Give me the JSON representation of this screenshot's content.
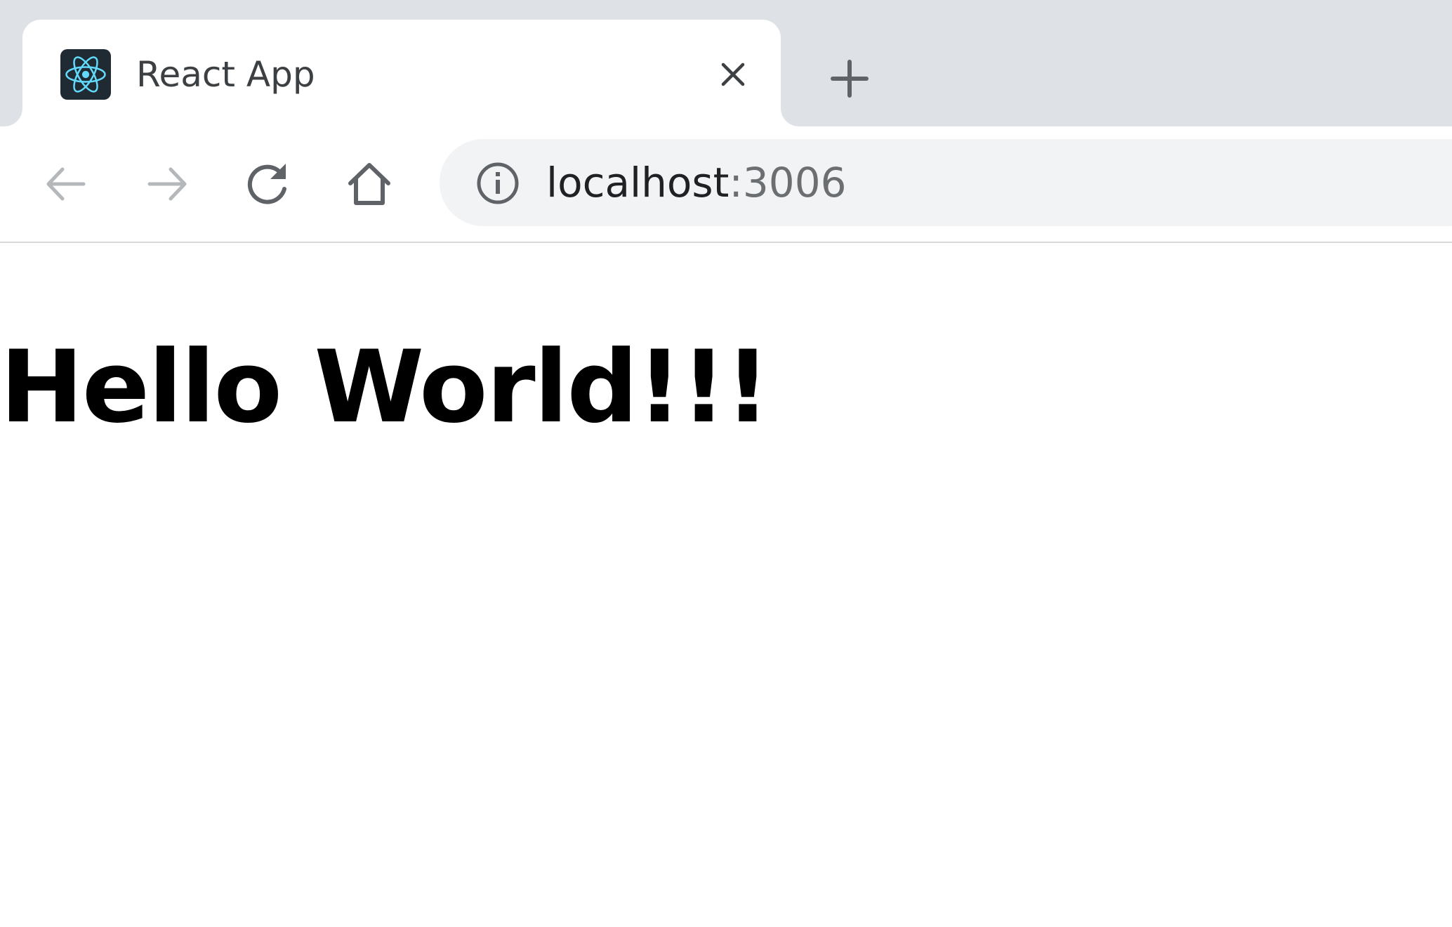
{
  "tab": {
    "title": "React App",
    "favicon": "react-logo-icon"
  },
  "toolbar": {
    "back_icon": "back-arrow-icon",
    "forward_icon": "forward-arrow-icon",
    "reload_icon": "reload-icon",
    "home_icon": "home-icon"
  },
  "omnibox": {
    "info_icon": "info-icon",
    "host": "localhost",
    "port": ":3006"
  },
  "page": {
    "heading": "Hello World!!!"
  },
  "colors": {
    "tabstrip": "#dee1e6",
    "omnibox_bg": "#f1f3f4",
    "react_blue": "#61dafb",
    "icon_gray": "#5f6368",
    "icon_disabled": "#b5b8bb"
  }
}
